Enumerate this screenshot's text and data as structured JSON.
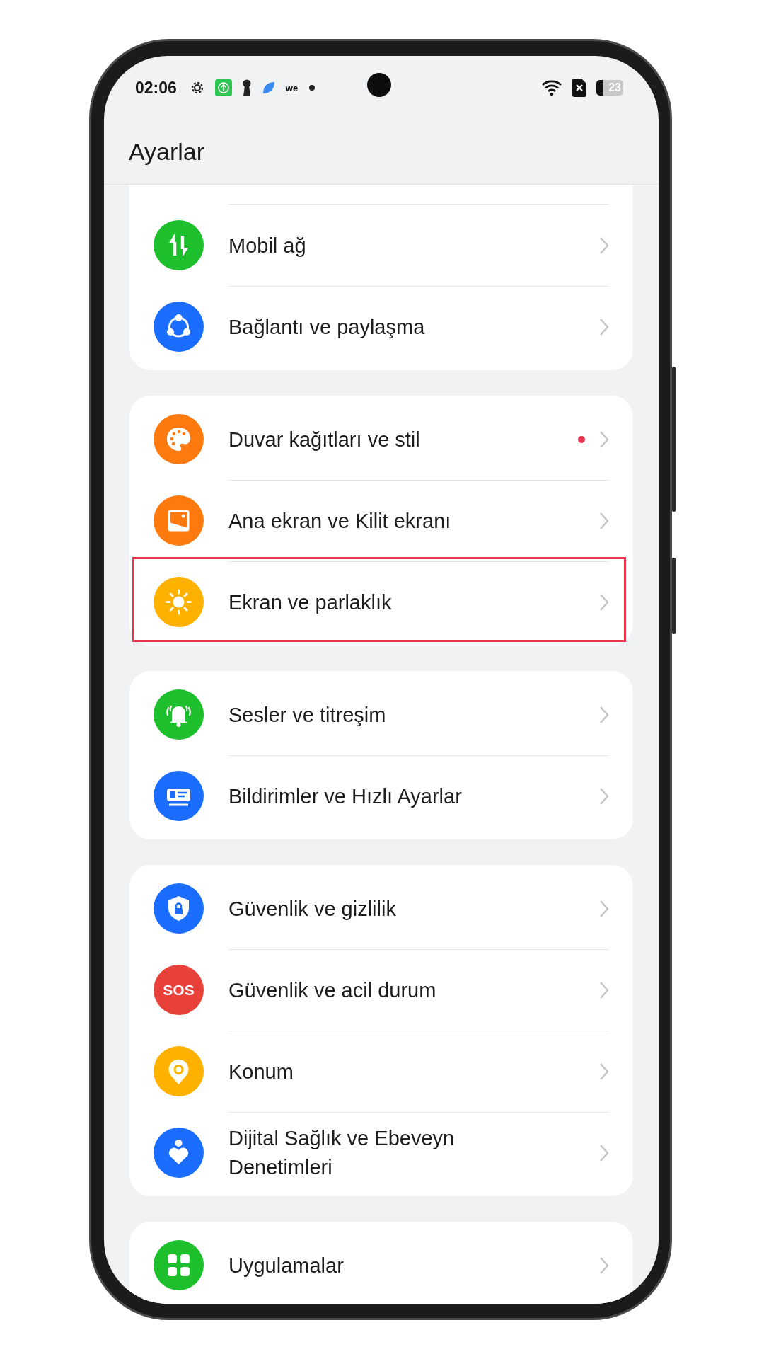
{
  "status_bar": {
    "time": "02:06",
    "notification_text": "we",
    "battery": "23"
  },
  "title": "Ayarlar",
  "groups": [
    {
      "clipped_top": true,
      "items": [
        {
          "label": "Mobil ağ",
          "kind": "mobile-data",
          "color": "#1dbf2c",
          "dot": false,
          "highlighted": false
        },
        {
          "label": "Bağlantı ve paylaşma",
          "kind": "share",
          "color": "#1a6dff",
          "dot": false,
          "highlighted": false
        }
      ]
    },
    {
      "clipped_top": false,
      "items": [
        {
          "label": "Duvar kağıtları ve stil",
          "kind": "palette",
          "color": "#ff7a0e",
          "dot": true,
          "highlighted": false
        },
        {
          "label": "Ana ekran ve Kilit ekranı",
          "kind": "wallpaper",
          "color": "#ff7a0e",
          "dot": false,
          "highlighted": false
        },
        {
          "label": "Ekran ve parlaklık",
          "kind": "sun",
          "color": "#ffb100",
          "dot": false,
          "highlighted": true
        }
      ]
    },
    {
      "clipped_top": false,
      "items": [
        {
          "label": "Sesler ve titreşim",
          "kind": "bell",
          "color": "#1dbf2c",
          "dot": false,
          "highlighted": false
        },
        {
          "label": "Bildirimler ve Hızlı Ayarlar",
          "kind": "card",
          "color": "#1a6dff",
          "dot": false,
          "highlighted": false
        }
      ]
    },
    {
      "clipped_top": false,
      "items": [
        {
          "label": "Güvenlik ve gizlilik",
          "kind": "shield",
          "color": "#1a6dff",
          "dot": false,
          "highlighted": false
        },
        {
          "label": "Güvenlik ve acil durum",
          "kind": "text",
          "icon_text": "SOS",
          "color": "#e8413a",
          "dot": false,
          "highlighted": false
        },
        {
          "label": "Konum",
          "kind": "pin",
          "color": "#ffb100",
          "dot": false,
          "highlighted": false
        },
        {
          "label": "Dijital Sağlık ve Ebeveyn Denetimleri",
          "kind": "person",
          "color": "#1a6dff",
          "dot": false,
          "highlighted": false
        }
      ]
    },
    {
      "clipped_top": false,
      "items": [
        {
          "label": "Uygulamalar",
          "kind": "apps",
          "color": "#1dbf2c",
          "dot": false,
          "highlighted": false
        }
      ]
    }
  ]
}
